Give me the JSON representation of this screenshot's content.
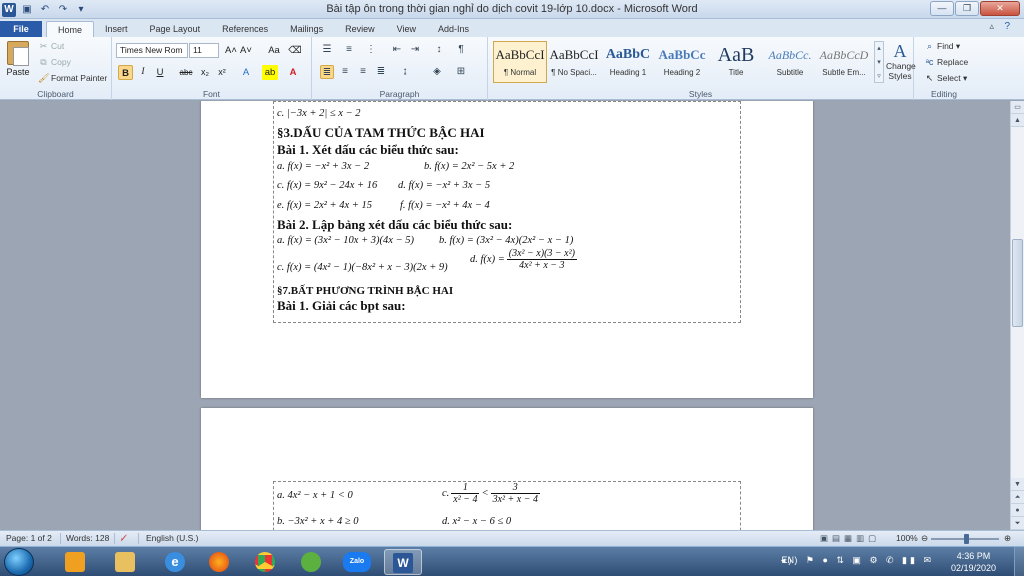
{
  "window": {
    "title": "Bài tập ôn trong thời gian nghỉ do dịch covit 19-lớp 10.docx - Microsoft Word",
    "app_icon": "W",
    "controls": [
      "minimize-icon",
      "restore-icon",
      "close-icon"
    ]
  },
  "ribbon": {
    "tabs": [
      {
        "label": "File"
      },
      {
        "label": "Home"
      },
      {
        "label": "Insert"
      },
      {
        "label": "Page Layout"
      },
      {
        "label": "References"
      },
      {
        "label": "Mailings"
      },
      {
        "label": "Review"
      },
      {
        "label": "View"
      },
      {
        "label": "Add-Ins"
      }
    ],
    "clipboard": {
      "paste": "Paste",
      "cut": "Cut",
      "copy": "Copy",
      "format_painter": "Format Painter",
      "label": "Clipboard"
    },
    "font": {
      "name": "Times New Rom",
      "size": "11",
      "grow": "A˄",
      "shrink": "A˅",
      "change_case": "Aa",
      "bold": "B",
      "italic": "I",
      "underline": "U",
      "strike": "abc",
      "subscript": "x₂",
      "superscript": "x²",
      "label": "Font"
    },
    "paragraph": {
      "label": "Paragraph"
    },
    "styles": {
      "items": [
        {
          "preview": "AaBbCcI",
          "name": "¶ Normal"
        },
        {
          "preview": "AaBbCcI",
          "name": "¶ No Spaci..."
        },
        {
          "preview": "AaBbC",
          "name": "Heading 1"
        },
        {
          "preview": "AaBbCc",
          "name": "Heading 2"
        },
        {
          "preview": "AaB",
          "name": "Title"
        },
        {
          "preview": "AaBbCc.",
          "name": "Subtitle"
        },
        {
          "preview": "AaBbCcD",
          "name": "Subtle Em..."
        }
      ],
      "change_styles": "Change Styles",
      "label": "Styles"
    },
    "editing": {
      "find": "Find",
      "replace": "Replace",
      "select": "Select",
      "label": "Editing"
    }
  },
  "document": {
    "page1": {
      "lines": {
        "l0": "c. |−3x + 2| ≤ x − 2",
        "h1": "§3.DẤU CỦA TAM THỨC BẬC HAI",
        "b1": "Bài 1. Xét dấu các biểu thức sau:",
        "e1a": "a. f(x) = −x² + 3x − 2",
        "e1b": "b. f(x) = 2x² − 5x + 2",
        "e2a": "c. f(x) = 9x² − 24x + 16",
        "e2b": "d. f(x) = −x² + 3x − 5",
        "e3a": "e. f(x) = 2x² + 4x + 15",
        "e3b": "f. f(x) = −x² + 4x − 4",
        "b2": "Bài 2. Lập bảng xét dấu các biểu thức sau:",
        "e4a": "a. f(x) = (3x² − 10x + 3)(4x − 5)",
        "e4b": "b. f(x) = (3x² − 4x)(2x² − x − 1)",
        "e5a": "c. f(x) = (4x² − 1)(−8x² + x − 3)(2x + 9)",
        "e5b_pre": "d. f(x) =",
        "e5b_num": "(3x² − x)(3 − x²)",
        "e5b_den": "4x² + x − 3",
        "h2": "§7.BẤT PHƯƠNG TRÌNH BẬC HAI",
        "b3": "Bài 1. Giải các bpt sau:"
      }
    },
    "page2": {
      "lines": {
        "p1a": "a. 4x² − x + 1 < 0",
        "p1b_pre": "c.",
        "p1b_num1": "1",
        "p1b_den1": "x² − 4",
        "p1b_op": "<",
        "p1b_num2": "3",
        "p1b_den2": "3x² + x − 4",
        "p2a": "b. −3x² + x + 4 ≥ 0",
        "p2b": "d. x² − x − 6 ≤ 0"
      }
    }
  },
  "statusbar": {
    "page": "Page: 1 of 2",
    "words": "Words: 128",
    "language": "English (U.S.)",
    "zoom": "100%",
    "zoom_level": 1.0
  },
  "taskbar": {
    "apps": [
      "start-button",
      "explorer-icon",
      "folder-icon",
      "ie-icon",
      "firefox-icon",
      "chrome-icon",
      "coccoc-icon",
      "zalo-icon",
      "word-icon"
    ],
    "zalo_label": "Zalo",
    "word_label": "W",
    "lang": "EN",
    "time": "4:36 PM",
    "date": "02/19/2020"
  }
}
